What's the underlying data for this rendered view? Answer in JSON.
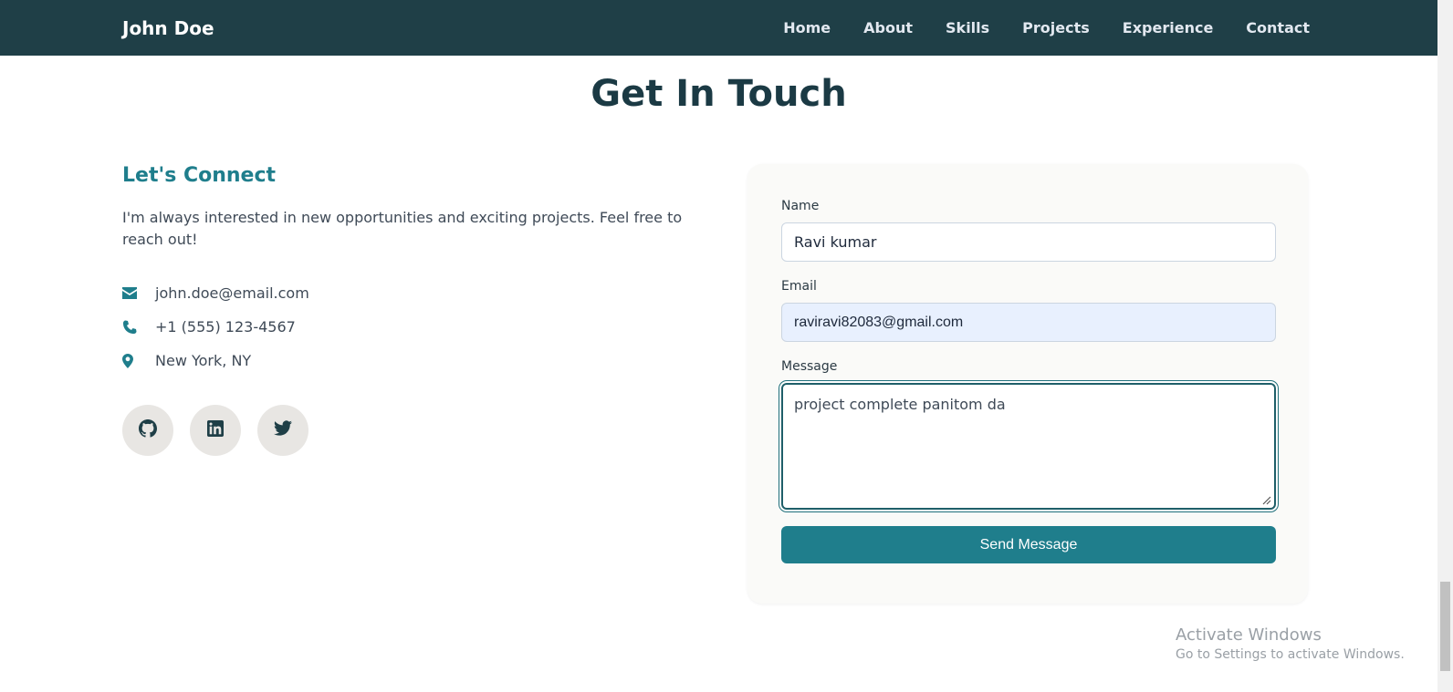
{
  "header": {
    "brand": "John Doe",
    "nav": [
      "Home",
      "About",
      "Skills",
      "Projects",
      "Experience",
      "Contact"
    ]
  },
  "section": {
    "title": "Get In Touch"
  },
  "connect": {
    "title": "Let's Connect",
    "text": "I'm always interested in new opportunities and exciting projects. Feel free to reach out!",
    "items": [
      {
        "icon": "envelope-icon",
        "text": "john.doe@email.com"
      },
      {
        "icon": "phone-icon",
        "text": "+1 (555) 123-4567"
      },
      {
        "icon": "map-pin-icon",
        "text": "New York, NY"
      }
    ],
    "socials": [
      "github-icon",
      "linkedin-icon",
      "twitter-icon"
    ]
  },
  "form": {
    "name_label": "Name",
    "name_value": "Ravi kumar",
    "email_label": "Email",
    "email_value": "raviravi82083@gmail.com",
    "message_label": "Message",
    "message_value": "project complete panitom da",
    "submit_label": "Send Message"
  },
  "watermark": {
    "title": "Activate Windows",
    "subtitle": "Go to Settings to activate Windows."
  },
  "colors": {
    "header_bg": "#1f3f47",
    "accent": "#1f7e8c",
    "autofill_bg": "#e8f0fe"
  }
}
